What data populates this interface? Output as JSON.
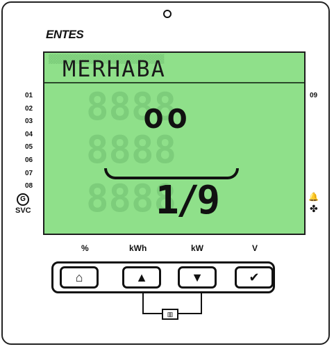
{
  "brand": "ENTES",
  "lcd": {
    "message": "MERHABA",
    "top_value": "oo",
    "bottom_value": "1/9"
  },
  "step_labels": [
    "01",
    "02",
    "03",
    "04",
    "05",
    "06",
    "07",
    "08"
  ],
  "right_label": "09",
  "svc_label": "SVC",
  "key_labels": [
    "%",
    "kWh",
    "kW",
    "V"
  ],
  "buttons": [
    {
      "icon": "home-icon",
      "glyph": "⌂"
    },
    {
      "icon": "up-arrow-icon",
      "glyph": "▲"
    },
    {
      "icon": "down-arrow-icon",
      "glyph": "▼"
    },
    {
      "icon": "check-icon",
      "glyph": "✔"
    }
  ],
  "colors": {
    "lcd_bg": "#8fe08a",
    "frame": "#111111"
  }
}
